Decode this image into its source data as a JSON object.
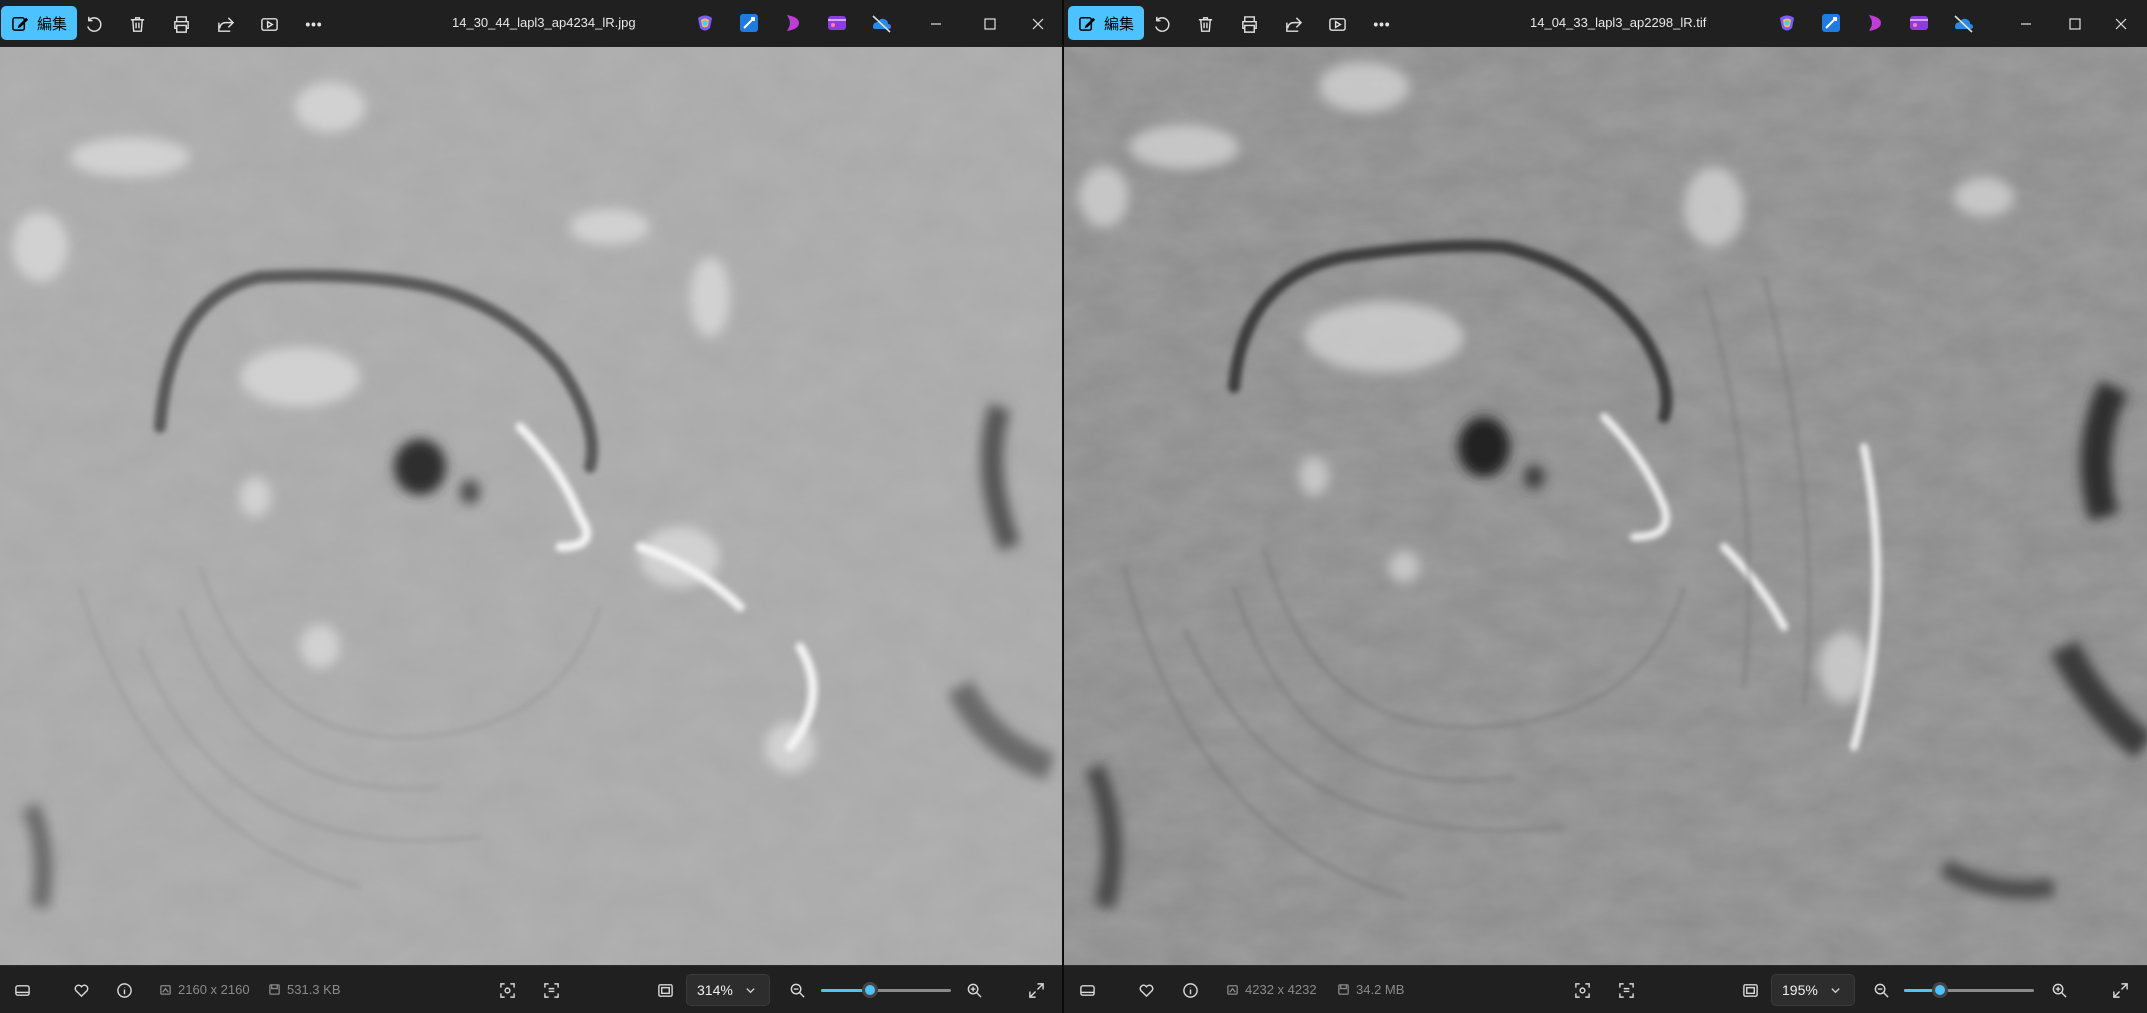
{
  "windows": [
    {
      "edit_label": "編集",
      "title": "14_30_44_lapl3_ap4234_lR.jpg",
      "dimensions": "2160 x 2160",
      "file_size": "531.3 KB",
      "zoom": "314%",
      "zoom_fraction": 0.38
    },
    {
      "edit_label": "編集",
      "title": "14_04_33_lapl3_ap2298_lR.tif",
      "dimensions": "4232 x 4232",
      "file_size": "34.2 MB",
      "zoom": "195%",
      "zoom_fraction": 0.28
    }
  ],
  "colors": {
    "accent": "#4cc2ff",
    "chrome": "#202020"
  },
  "icons": [
    "edit-icon",
    "rotate-icon",
    "delete-icon",
    "print-icon",
    "share-icon",
    "slideshow-icon",
    "more-icon",
    "copilot-icon",
    "designer-icon",
    "clipchamp-icon",
    "video-editor-icon",
    "onedrive-icon",
    "minimize-icon",
    "maximize-icon",
    "close-icon",
    "filmstrip-icon",
    "favorite-icon",
    "info-icon",
    "dimensions-icon",
    "file-size-icon",
    "face-detect-icon",
    "ocr-icon",
    "fit-icon",
    "chevron-down-icon",
    "zoom-out-icon",
    "zoom-in-icon",
    "full-screen-icon"
  ]
}
